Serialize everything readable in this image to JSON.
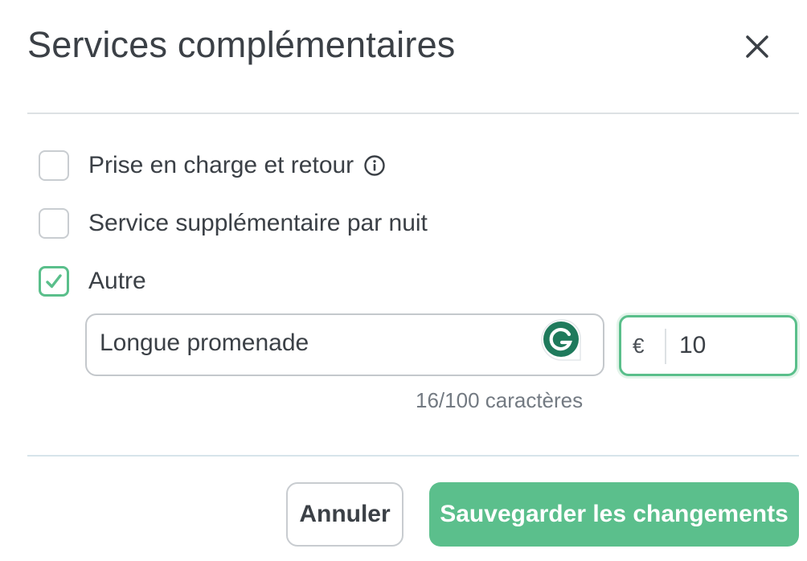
{
  "dialog": {
    "title": "Services complémentaires",
    "close_icon": "close-icon"
  },
  "options": [
    {
      "label": "Prise en charge et retour",
      "checked": false,
      "info_icon": "info-icon"
    },
    {
      "label": "Service supplémentaire par nuit",
      "checked": false
    },
    {
      "label": "Autre",
      "checked": true
    }
  ],
  "other_service": {
    "name_value": "Longue promenade",
    "char_counter": "16/100 caractères",
    "extension_icon": "grammarly-icon",
    "currency_symbol": "€",
    "price_value": "10"
  },
  "footer": {
    "cancel_label": "Annuler",
    "save_label": "Sauvegarder les changements"
  },
  "colors": {
    "accent": "#5bbf8c",
    "text": "#3b4046",
    "muted": "#737a82",
    "border": "#c8ccd0"
  }
}
